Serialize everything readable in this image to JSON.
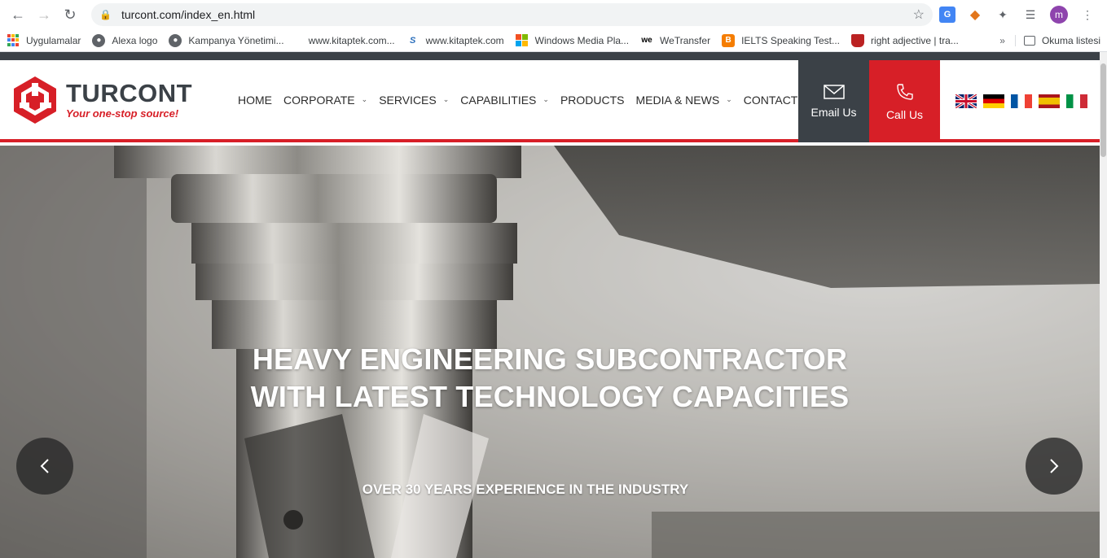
{
  "browser": {
    "url": "turcont.com/index_en.html",
    "avatar_letter": "m",
    "bookmarks": [
      {
        "label": "Uygulamalar",
        "icon": "apps-grid-icon"
      },
      {
        "label": "Alexa logo",
        "icon": "globe-icon"
      },
      {
        "label": "Kampanya Yönetimi...",
        "icon": "globe-icon"
      },
      {
        "label": "www.kitaptek.com...",
        "icon": "none"
      },
      {
        "label": "www.kitaptek.com",
        "icon": "s-logo-icon"
      },
      {
        "label": "Windows Media Pla...",
        "icon": "windows-logo-icon"
      },
      {
        "label": "WeTransfer",
        "icon": "wetransfer-icon"
      },
      {
        "label": "IELTS Speaking Test...",
        "icon": "blogger-icon"
      },
      {
        "label": "right adjective | tra...",
        "icon": "crest-icon"
      }
    ],
    "more_label": "»",
    "reading_list_label": "Okuma listesi"
  },
  "site": {
    "logo_name": "TURCONT",
    "logo_tagline": "Your one-stop source!",
    "menu": [
      {
        "label": "HOME",
        "dropdown": false
      },
      {
        "label": "CORPORATE",
        "dropdown": true
      },
      {
        "label": "SERVICES",
        "dropdown": true
      },
      {
        "label": "CAPABILITIES",
        "dropdown": true
      },
      {
        "label": "PRODUCTS",
        "dropdown": false
      },
      {
        "label": "MEDIA & NEWS",
        "dropdown": true
      },
      {
        "label": "CONTACT",
        "dropdown": false
      }
    ],
    "email_label": "Email Us",
    "call_label": "Call Us",
    "languages": [
      "English",
      "Deutsch",
      "Français",
      "Español",
      "Italiano"
    ],
    "colors": {
      "brand_red": "#d71f27",
      "brand_dark": "#3b4147"
    }
  },
  "hero": {
    "title_line1": "HEAVY ENGINEERING SUBCONTRACTOR",
    "title_line2": "WITH LATEST TECHNOLOGY CAPACITIES",
    "subtitle": "OVER 30 YEARS EXPERIENCE IN THE INDUSTRY",
    "prev_arrow": "‹",
    "next_arrow": "›"
  }
}
